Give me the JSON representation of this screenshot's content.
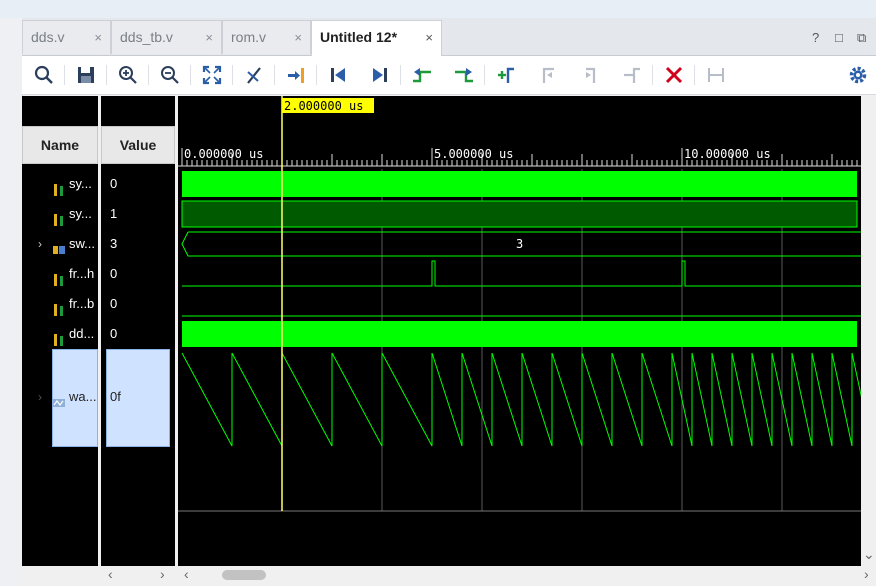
{
  "tabs": [
    {
      "label": "dds.v",
      "active": false
    },
    {
      "label": "dds_tb.v",
      "active": false
    },
    {
      "label": "rom.v",
      "active": false
    },
    {
      "label": "Untitled 12*",
      "active": true
    }
  ],
  "tab_close_glyph": "×",
  "window_controls": [
    "?",
    "□",
    "⧉"
  ],
  "toolbar_icons": [
    "search-icon",
    "save-icon",
    "zoom-in-icon",
    "zoom-out-icon",
    "zoom-fit-icon",
    "cursor-mark-icon",
    "go-to-cursor-icon",
    "go-to-start-icon",
    "go-to-end-icon",
    "previous-transition-icon",
    "next-transition-icon",
    "add-marker-icon",
    "previous-marker-icon",
    "next-marker-icon",
    "swap-cursors-icon",
    "delete-icon",
    "marker-span-icon",
    "settings-gear-icon"
  ],
  "columns": {
    "name": "Name",
    "value": "Value"
  },
  "signals": [
    {
      "name": "sy...",
      "value": "0",
      "type": "bit"
    },
    {
      "name": "sy...",
      "value": "1",
      "type": "bit"
    },
    {
      "name": "sw...",
      "value": "3",
      "type": "bus",
      "expandable": true
    },
    {
      "name": "fr...h",
      "value": "0",
      "type": "bit"
    },
    {
      "name": "fr...b",
      "value": "0",
      "type": "bit"
    },
    {
      "name": "dd...",
      "value": "0",
      "type": "bit"
    },
    {
      "name": "wa...",
      "value": "0f",
      "type": "analog",
      "expandable": true,
      "selected": true
    }
  ],
  "cursor": {
    "label": "2.000000 us",
    "time_us": 2
  },
  "timeline": {
    "start_us": 0,
    "end_us": 13.5,
    "labels": [
      "0.000000 us",
      "5.000000 us",
      "10.000000 us"
    ],
    "label_times": [
      0,
      5,
      10
    ]
  },
  "waveforms": {
    "bus_value_text": "3",
    "pulse_times_us": [
      5,
      10
    ],
    "sawtooth_periods_us": [
      1,
      1,
      1,
      1,
      1,
      0.6,
      0.6,
      0.6,
      0.6,
      0.6,
      0.6,
      0.6,
      0.6,
      0.4,
      0.4,
      0.4,
      0.4,
      0.4,
      0.4,
      0.4,
      0.4,
      0.4,
      0.4
    ]
  },
  "colors": {
    "wave": "#00ff00",
    "wave_dark": "#005a00",
    "cursor": "#ffff66",
    "cursor_label_bg": "#ffff00",
    "delete": "#d0021b",
    "accent": "#2b6cb0"
  }
}
